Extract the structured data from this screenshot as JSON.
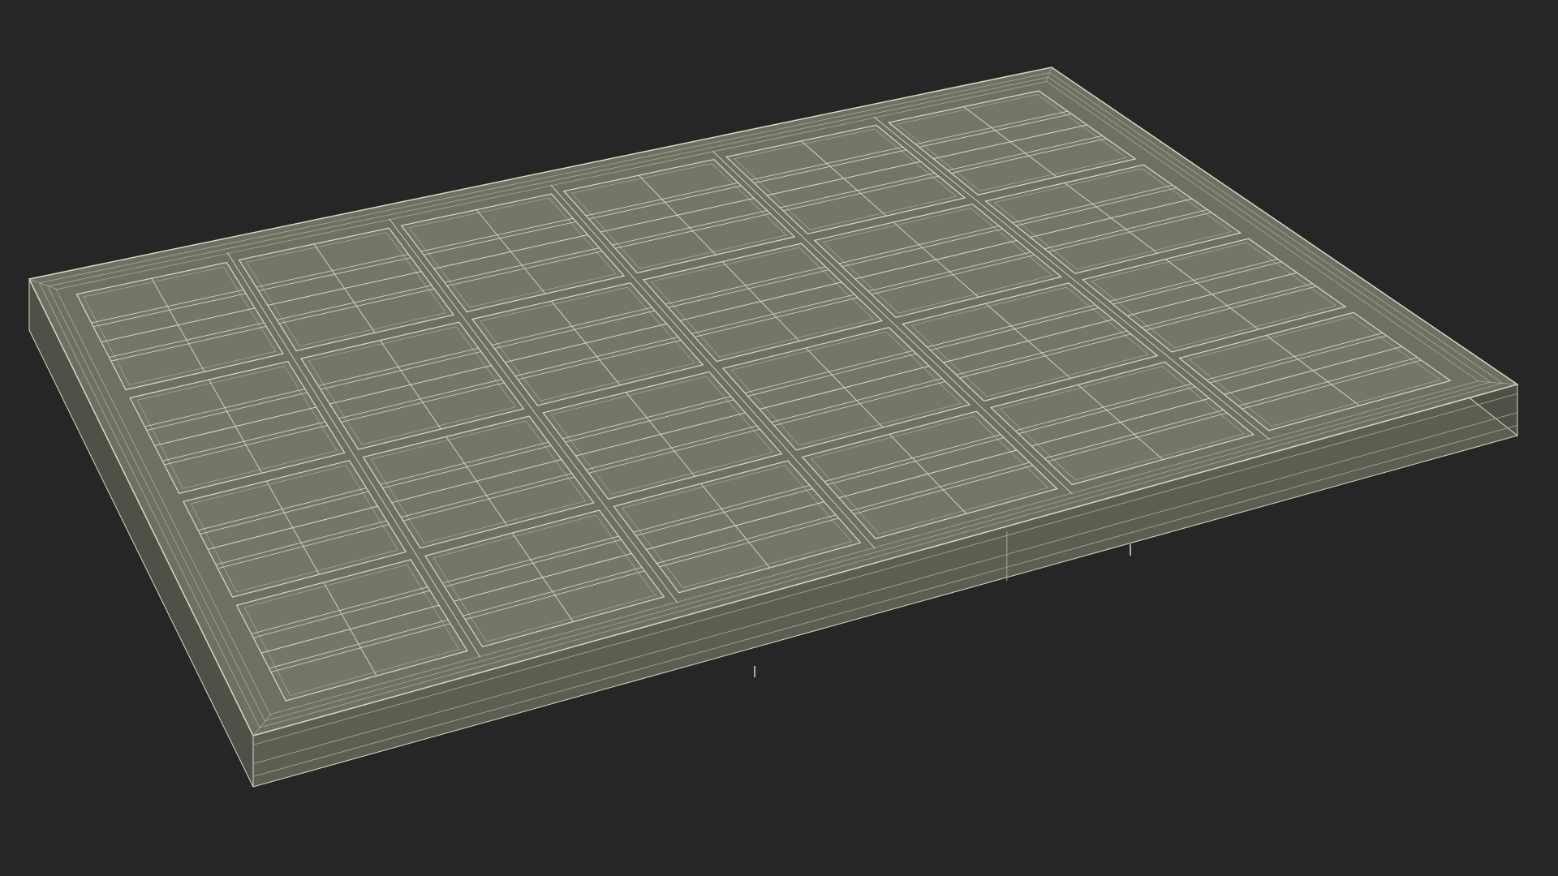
{
  "scene": {
    "subject": "solar-panel-wireframe",
    "cell_grid": {
      "columns": 6,
      "rows": 4
    },
    "colors": {
      "background": "#262626",
      "top_surface": "#6f6f63",
      "cell_surface": "#75756a",
      "side_front": "#5d5d52",
      "side_right": "#505047",
      "wire": "#d8d8c4",
      "wire_dim": "#a9a995"
    }
  }
}
